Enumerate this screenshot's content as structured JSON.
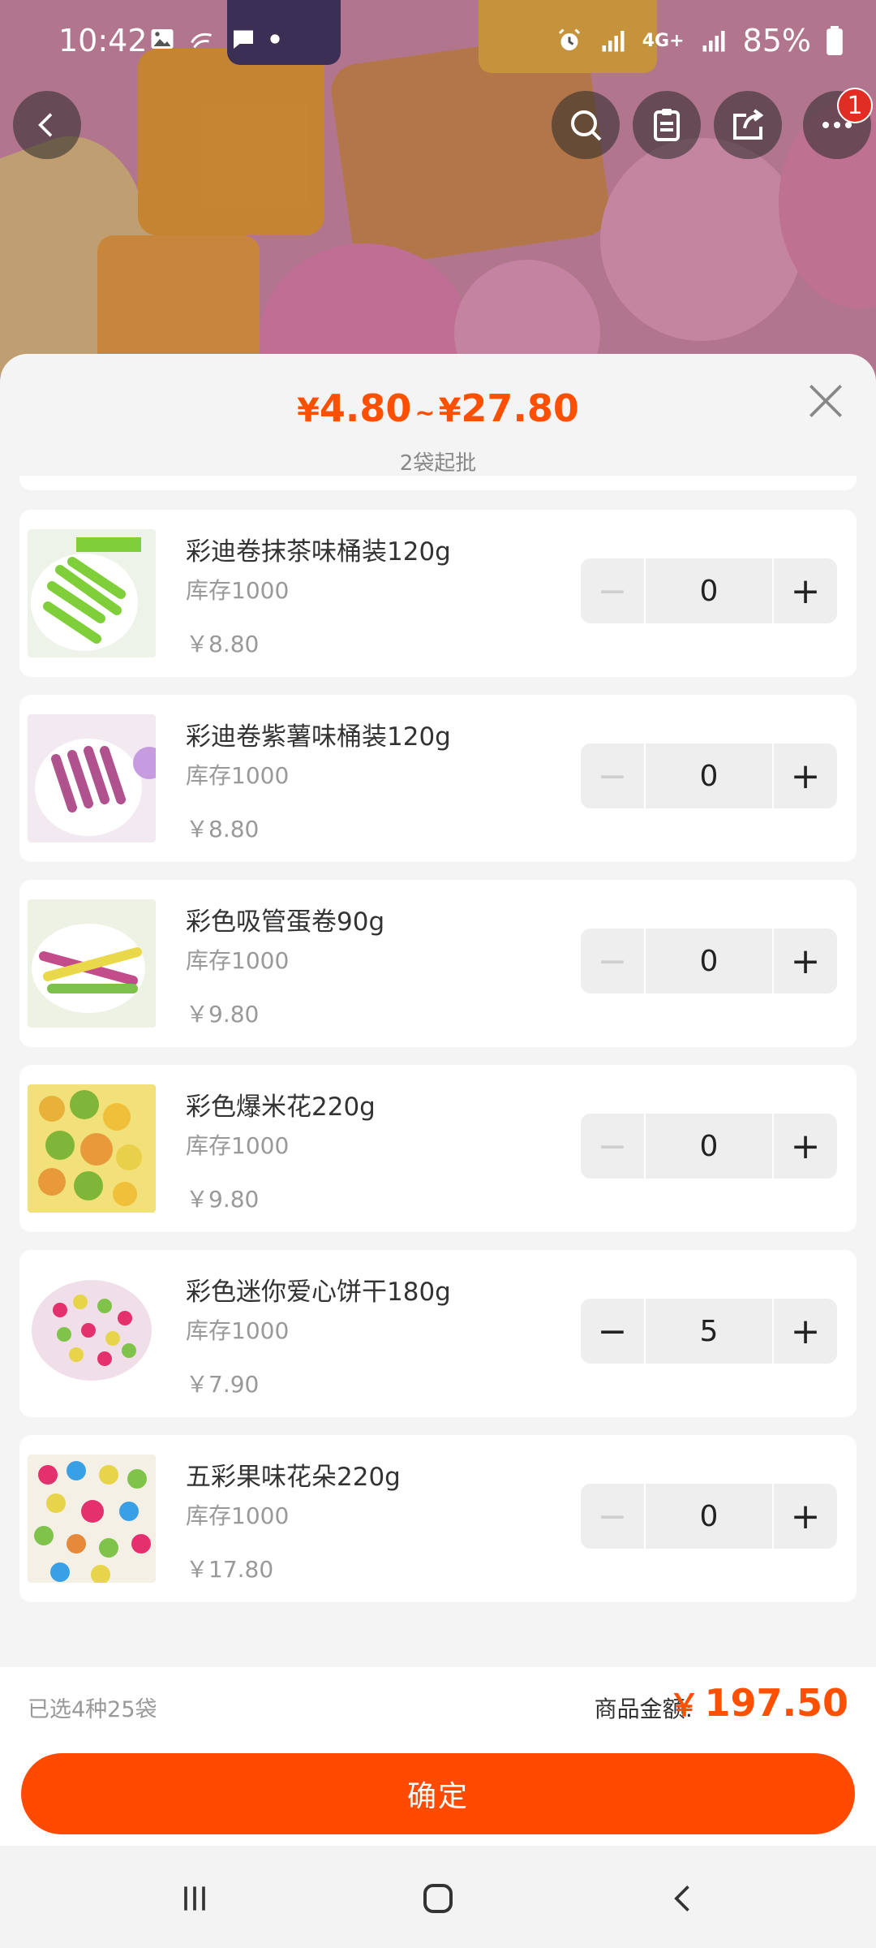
{
  "status_bar": {
    "time": "10:42",
    "network": "4G+",
    "battery": "85%"
  },
  "header": {
    "cart_badge": "1"
  },
  "sheet": {
    "price_min": "4.80",
    "price_max": "27.80",
    "currency": "¥",
    "tilde": "~",
    "min_order": "2袋起批"
  },
  "products": [
    {
      "name": "彩迪卷抹茶味桶装120g",
      "stock": "库存1000",
      "price": "￥8.80",
      "qty": "0",
      "minus_disabled": true
    },
    {
      "name": "彩迪卷紫薯味桶装120g",
      "stock": "库存1000",
      "price": "￥8.80",
      "qty": "0",
      "minus_disabled": true
    },
    {
      "name": "彩色吸管蛋卷90g",
      "stock": "库存1000",
      "price": "￥9.80",
      "qty": "0",
      "minus_disabled": true
    },
    {
      "name": "彩色爆米花220g",
      "stock": "库存1000",
      "price": "￥9.80",
      "qty": "0",
      "minus_disabled": true
    },
    {
      "name": "彩色迷你爱心饼干180g",
      "stock": "库存1000",
      "price": "￥7.90",
      "qty": "5",
      "minus_disabled": false
    },
    {
      "name": "五彩果味花朵220g",
      "stock": "库存1000",
      "price": "￥17.80",
      "qty": "0",
      "minus_disabled": true
    }
  ],
  "stepper": {
    "minus": "−",
    "plus": "+"
  },
  "footer": {
    "selected_summary": "已选4种25袋",
    "amount_label": "商品金额:",
    "amount_currency": "￥",
    "amount_value": "197.50",
    "confirm_label": "确定"
  },
  "colors": {
    "accent": "#ff4a00",
    "price": "#ff4f00",
    "badge": "#e02e24"
  }
}
